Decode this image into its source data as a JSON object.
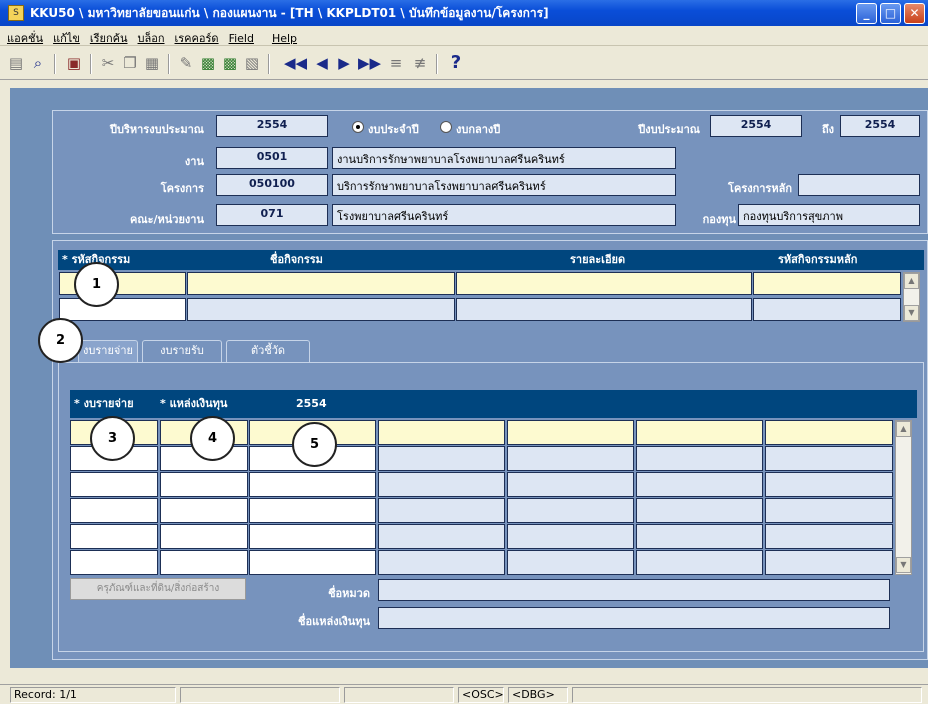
{
  "window": {
    "title": "KKU50 \\ มหาวิทยาลัยขอนแก่น \\ กองแผนงาน - [TH \\ KKPLDT01 \\ บันทึกข้อมูลงาน/โครงการ]",
    "app_icon_text": "S"
  },
  "menu": [
    "แอคชั่น",
    "แก้ไข",
    "เรียกค้น",
    "บล็อก",
    "เรคคอร์ด",
    "Field",
    "Help"
  ],
  "toolbar": {
    "icons": [
      "save-icon",
      "print-preview-icon",
      "exit-icon",
      "cut-icon",
      "copy-icon",
      "paste-icon",
      "clear-icon",
      "insert-record-icon",
      "duplicate-record-icon",
      "delete-record-icon",
      "first-record-icon",
      "previous-record-icon",
      "next-record-icon",
      "last-record-icon",
      "query-icon",
      "cancel-query-icon",
      "help-icon"
    ]
  },
  "header_form": {
    "fiscal_admin_label": "ปีบริหารงบประมาณ",
    "fiscal_admin_value": "2554",
    "radio_annual": "งบประจำปี",
    "radio_mid": "งบกลางปี",
    "budget_year_label": "ปีงบประมาณ",
    "budget_year_from": "2554",
    "to_label": "ถึง",
    "budget_year_to": "2554",
    "job_label": "งาน",
    "job_code": "0501",
    "job_name": "งานบริการรักษาพยาบาลโรงพยาบาลศรีนครินทร์",
    "project_label": "โครงการ",
    "project_code": "050100",
    "project_name": "บริการรักษาพยาบาลโรงพยาบาลศรีนครินทร์",
    "main_project_label": "โครงการหลัก",
    "main_project_value": "",
    "unit_label": "คณะ/หน่วยงาน",
    "unit_code": "071",
    "unit_name": "โรงพยาบาลศรีนครินทร์",
    "fund_label": "กองทุน",
    "fund_value": "กองทุนบริการสุขภาพ"
  },
  "activity_table": {
    "columns": [
      "* รหัสกิจกรรม",
      "ชื่อกิจกรรม",
      "รายละเอียด",
      "รหัสกิจกรรมหลัก"
    ]
  },
  "tabs": [
    "งบรายจ่าย",
    "งบรายรับ",
    "ตัวชี้วัด"
  ],
  "expense_table": {
    "col_expense": "* งบรายจ่าย",
    "col_fund_source": "* แหล่งเงินทุน",
    "col_year": "2554"
  },
  "durable_button": "ครุภัณฑ์และที่ดิน/สิ่งก่อสร้าง",
  "category_name_label": "ชื่อหมวด",
  "fund_source_name_label": "ชื่อแหล่งเงินทุน",
  "callouts": [
    "1",
    "2",
    "3",
    "4",
    "5"
  ],
  "status": {
    "record": "Record: 1/1",
    "osc": "<OSC>",
    "dbg": "<DBG>"
  }
}
